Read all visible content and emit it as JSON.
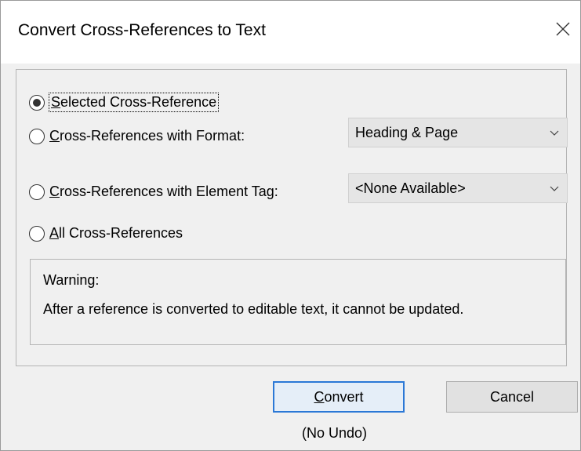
{
  "window": {
    "title": "Convert Cross-References to Text"
  },
  "options": {
    "selected": {
      "label_underlined": "S",
      "label_rest": "elected Cross-Reference",
      "checked": true
    },
    "with_format": {
      "label_underlined": "C",
      "label_rest": "ross-References with Format:",
      "checked": false
    },
    "with_element_tag": {
      "label_underlined": "C",
      "label_rest": "ross-References with Element Tag:",
      "checked": false
    },
    "all": {
      "label_underlined": "A",
      "label_rest": "ll Cross-References",
      "checked": false
    }
  },
  "format_select": {
    "value": "Heading & Page"
  },
  "element_tag_select": {
    "value": "<None Available>"
  },
  "warning": {
    "title": "Warning:",
    "text": "After a reference is converted to editable text, it cannot be updated."
  },
  "buttons": {
    "convert_underlined": "C",
    "convert_rest": "onvert",
    "cancel": "Cancel"
  },
  "footer": {
    "no_undo": "(No Undo)"
  },
  "icons": {
    "close": "close-icon",
    "dropdown": "chevron-down-icon"
  }
}
